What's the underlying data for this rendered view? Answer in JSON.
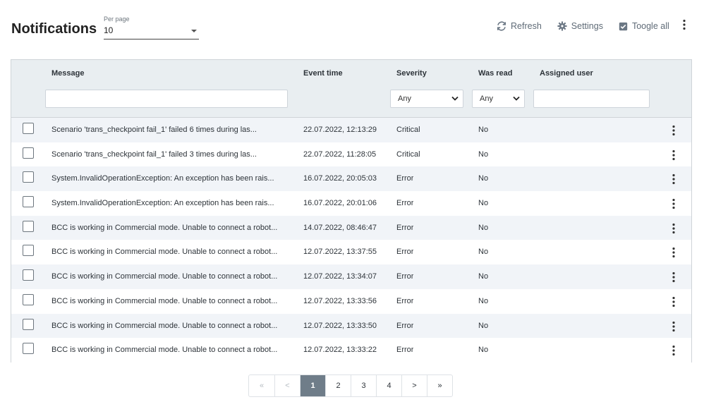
{
  "page": {
    "title": "Notifications"
  },
  "per_page": {
    "label": "Per page",
    "value": "10"
  },
  "toolbar": {
    "refresh": "Refresh",
    "settings": "Settings",
    "toggle_all": "Toogle all"
  },
  "columns": {
    "message": "Message",
    "event_time": "Event time",
    "severity": "Severity",
    "was_read": "Was read",
    "assigned_user": "Assigned user"
  },
  "filters": {
    "message": "",
    "severity": "Any",
    "was_read": "Any",
    "assigned_user": ""
  },
  "rows": [
    {
      "message": "Scenario 'trans_checkpoint fail_1' failed 6 times during las...",
      "event_time": "22.07.2022, 12:13:29",
      "severity": "Critical",
      "was_read": "No",
      "assigned_user": ""
    },
    {
      "message": "Scenario 'trans_checkpoint fail_1' failed 3 times during las...",
      "event_time": "22.07.2022, 11:28:05",
      "severity": "Critical",
      "was_read": "No",
      "assigned_user": ""
    },
    {
      "message": "System.InvalidOperationException: An exception has been rais...",
      "event_time": "16.07.2022, 20:05:03",
      "severity": "Error",
      "was_read": "No",
      "assigned_user": ""
    },
    {
      "message": "System.InvalidOperationException: An exception has been rais...",
      "event_time": "16.07.2022, 20:01:06",
      "severity": "Error",
      "was_read": "No",
      "assigned_user": ""
    },
    {
      "message": "BCC is working in Commercial mode. Unable to connect a robot...",
      "event_time": "14.07.2022, 08:46:47",
      "severity": "Error",
      "was_read": "No",
      "assigned_user": ""
    },
    {
      "message": "BCC is working in Commercial mode. Unable to connect a robot...",
      "event_time": "12.07.2022, 13:37:55",
      "severity": "Error",
      "was_read": "No",
      "assigned_user": ""
    },
    {
      "message": "BCC is working in Commercial mode. Unable to connect a robot...",
      "event_time": "12.07.2022, 13:34:07",
      "severity": "Error",
      "was_read": "No",
      "assigned_user": ""
    },
    {
      "message": "BCC is working in Commercial mode. Unable to connect a robot...",
      "event_time": "12.07.2022, 13:33:56",
      "severity": "Error",
      "was_read": "No",
      "assigned_user": ""
    },
    {
      "message": "BCC is working in Commercial mode. Unable to connect a robot...",
      "event_time": "12.07.2022, 13:33:50",
      "severity": "Error",
      "was_read": "No",
      "assigned_user": ""
    },
    {
      "message": "BCC is working in Commercial mode. Unable to connect a robot...",
      "event_time": "12.07.2022, 13:33:22",
      "severity": "Error",
      "was_read": "No",
      "assigned_user": ""
    }
  ],
  "pagination": {
    "first": "«",
    "prev": "<",
    "next": ">",
    "last": "»",
    "pages": [
      "1",
      "2",
      "3",
      "4"
    ],
    "current": "1"
  },
  "icons": {
    "refresh": "refresh-icon",
    "settings": "gear-icon",
    "toggle_all": "checkbox-checked-icon",
    "more": "kebab-icon"
  },
  "colors": {
    "header_bg": "#e9eef1",
    "row_alt": "#f1f4f8",
    "active_page": "#6f7d89",
    "toolbar_text": "#5f6b77"
  }
}
